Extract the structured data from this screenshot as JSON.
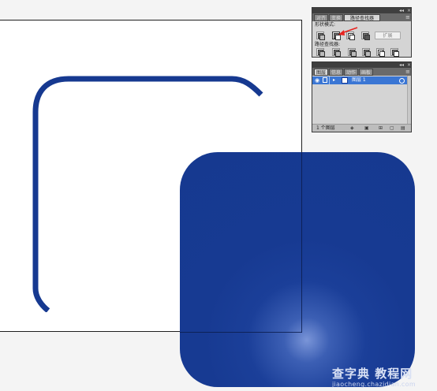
{
  "pathfinder_panel": {
    "tabs": [
      "对齐",
      "变换",
      "路径查找器"
    ],
    "active_tab": 2,
    "shape_modes_label": "形状模式:",
    "expand_label": "扩展",
    "pathfinders_label": "路径查找器:"
  },
  "layers_panel": {
    "tabs": [
      "图层",
      "信息",
      "动作",
      "画板"
    ],
    "active_tab": 0,
    "layer_name": "图层 1",
    "layer_count": "1 个图层"
  },
  "watermark": {
    "main": "查字典 教程网",
    "url": "jiaocheng.chazidian.com"
  },
  "colors": {
    "shape_blue": "#163990",
    "annotation_arrow": "#e8231f",
    "selection_blue": "#3a76d4"
  },
  "icons": {
    "visibility": "eye-icon",
    "arrow": "red-arrow-icon"
  }
}
